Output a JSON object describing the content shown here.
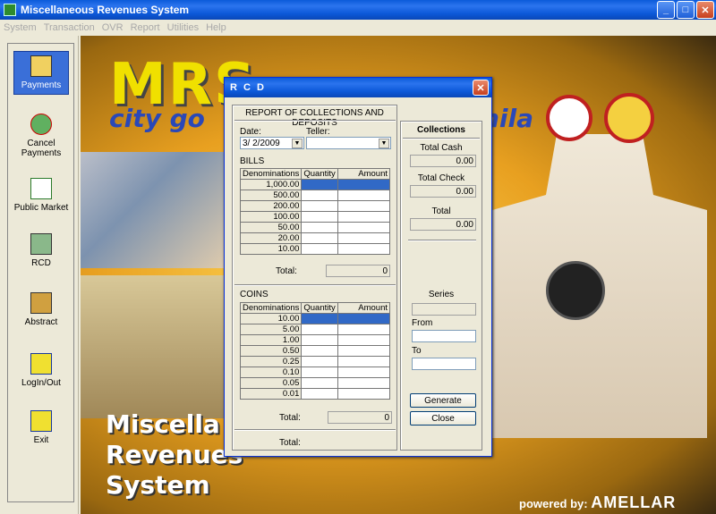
{
  "window": {
    "title": "Miscellaneous Revenues System"
  },
  "menu": [
    "System",
    "Transaction",
    "OVR",
    "Report",
    "Utilities",
    "Help"
  ],
  "sidebar": {
    "items": [
      {
        "label": "Payments",
        "icon": "payments-icon"
      },
      {
        "label": "Cancel Payments",
        "icon": "cancel-payments-icon"
      },
      {
        "label": "Public Market",
        "icon": "public-market-icon"
      },
      {
        "label": "RCD",
        "icon": "rcd-icon"
      },
      {
        "label": "Abstract",
        "icon": "abstract-icon"
      },
      {
        "label": "LogIn/Out",
        "icon": "login-icon"
      },
      {
        "label": "Exit",
        "icon": "exit-icon"
      }
    ]
  },
  "background": {
    "logo_mrs": "MRS",
    "logo_city": "city go",
    "logo_ila": "nila",
    "big_text": [
      "Miscella",
      "Revenues",
      "System"
    ],
    "powered_by": "powered by:",
    "brand": "AMELLAR"
  },
  "dialog": {
    "title": "R C D",
    "header": "REPORT OF COLLECTIONS AND DEPOSITS",
    "date_label": "Date:",
    "date_value": "3/ 2/2009",
    "teller_label": "Teller:",
    "teller_value": "",
    "bills_label": "BILLS",
    "coins_label": "COINS",
    "col_denominations": "Denominations",
    "col_quantity": "Quantity",
    "col_amount": "Amount",
    "bills": [
      "1,000.00",
      "500.00",
      "200.00",
      "100.00",
      "50.00",
      "20.00",
      "10.00"
    ],
    "coins": [
      "10.00",
      "5.00",
      "1.00",
      "0.50",
      "0.25",
      "0.10",
      "0.05",
      "0.01"
    ],
    "bills_total_label": "Total:",
    "bills_total": "0",
    "coins_total_label": "Total:",
    "coins_total": "0",
    "grand_total_label": "Total:",
    "collections": {
      "heading": "Collections",
      "total_cash_label": "Total Cash",
      "total_cash": "0.00",
      "total_check_label": "Total Check",
      "total_check": "0.00",
      "total_label": "Total",
      "total": "0.00",
      "series_label": "Series",
      "from_label": "From",
      "to_label": "To",
      "generate": "Generate",
      "close": "Close"
    }
  }
}
